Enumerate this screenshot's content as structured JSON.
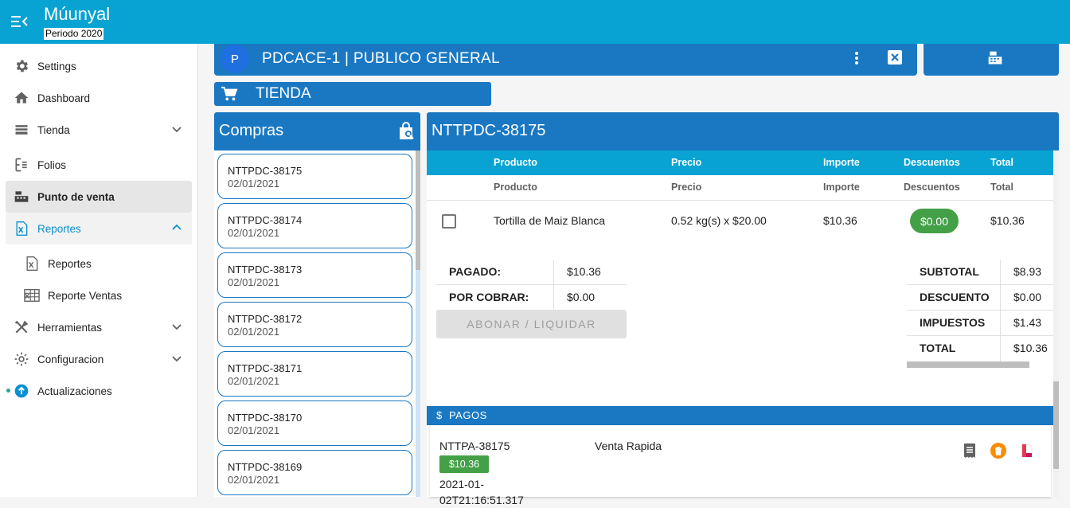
{
  "app": {
    "title": "Múunyal",
    "period": "Periodo 2020"
  },
  "sidebar": {
    "items": [
      {
        "label": "Settings",
        "icon": "gear-icon"
      },
      {
        "label": "Dashboard",
        "icon": "home-icon"
      },
      {
        "label": "Tienda",
        "icon": "register-icon"
      },
      {
        "label": "Folios",
        "icon": "folio-icon"
      },
      {
        "label": "Punto de venta",
        "icon": "cash-register-icon"
      },
      {
        "label": "Reportes",
        "icon": "excel-icon"
      },
      {
        "label": "Reportes",
        "icon": "excel-file-icon"
      },
      {
        "label": "Reporte Ventas",
        "icon": "spreadsheet-icon"
      },
      {
        "label": "Herramientas",
        "icon": "tools-icon"
      },
      {
        "label": "Configuracion",
        "icon": "settings-icon"
      },
      {
        "label": "Actualizaciones",
        "icon": "upload-icon"
      }
    ]
  },
  "header": {
    "avatar": "P",
    "title": "PDCACE-1 | PUBLICO GENERAL"
  },
  "tienda": {
    "label": "TIENDA"
  },
  "compras": {
    "title": "Compras",
    "items": [
      {
        "folio": "NTTPDC-38175",
        "date": "02/01/2021"
      },
      {
        "folio": "NTTPDC-38174",
        "date": "02/01/2021"
      },
      {
        "folio": "NTTPDC-38173",
        "date": "02/01/2021"
      },
      {
        "folio": "NTTPDC-38172",
        "date": "02/01/2021"
      },
      {
        "folio": "NTTPDC-38171",
        "date": "02/01/2021"
      },
      {
        "folio": "NTTPDC-38170",
        "date": "02/01/2021"
      },
      {
        "folio": "NTTPDC-38169",
        "date": "02/01/2021"
      }
    ]
  },
  "detail": {
    "title": "NTTPDC-38175",
    "columns": [
      "Producto",
      "Precio",
      "Importe",
      "Descuentos",
      "Total"
    ],
    "row": {
      "producto": "Tortilla de Maiz Blanca",
      "precio": "0.52 kg(s) x $20.00",
      "importe": "$10.36",
      "descuento": "$0.00",
      "total": "$10.36"
    },
    "pagado_label": "PAGADO:",
    "pagado": "$10.36",
    "por_cobrar_label": "POR COBRAR:",
    "por_cobrar": "$0.00",
    "abonar_label": "ABONAR / LIQUIDAR",
    "subtotal_label": "SUBTOTAL",
    "subtotal": "$8.93",
    "descuento_label": "DESCUENTO",
    "descuento": "$0.00",
    "impuestos_label": "IMPUESTOS",
    "impuestos": "$1.43",
    "total_label": "TOTAL",
    "total": "$10.36"
  },
  "pagos": {
    "label": "PAGOS",
    "folio": "NTTPA-38175",
    "amount": "$10.36",
    "date": "2021-01-02T21:16:51.317",
    "type": "Venta Rapida"
  },
  "colors": {
    "primary": "#1a78c2",
    "topbar": "#08a3d2",
    "success": "#43a047",
    "accent": "#0a8fd0"
  }
}
